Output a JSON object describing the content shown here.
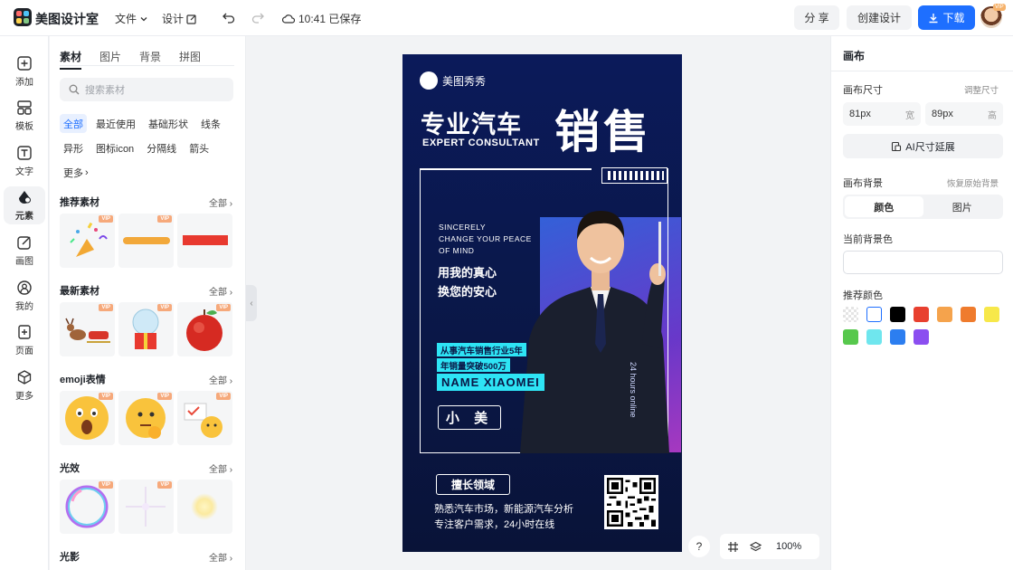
{
  "topbar": {
    "app_title": "美图设计室",
    "menu_file": "文件",
    "menu_design": "设计",
    "saved_status": "10:41 已保存",
    "share_label": "分 享",
    "create_label": "创建设计",
    "download_label": "下载",
    "avatar_badge": "VIP"
  },
  "rail": {
    "items": [
      {
        "label": "添加",
        "icon": "plus-square-icon"
      },
      {
        "label": "模板",
        "icon": "template-icon"
      },
      {
        "label": "文字",
        "icon": "text-icon"
      },
      {
        "label": "元素",
        "icon": "shapes-icon"
      },
      {
        "label": "画图",
        "icon": "draw-icon"
      },
      {
        "label": "我的",
        "icon": "user-icon"
      },
      {
        "label": "页面",
        "icon": "page-add-icon"
      },
      {
        "label": "更多",
        "icon": "cube-icon"
      }
    ]
  },
  "panel": {
    "tabs": [
      "素材",
      "图片",
      "背景",
      "拼图"
    ],
    "search_placeholder": "搜索素材",
    "tags": [
      "全部",
      "最近使用",
      "基础形状",
      "线条",
      "异形",
      "图标icon",
      "分隔线",
      "箭头",
      "更多"
    ],
    "all_label": "全部",
    "vip_label": "VIP",
    "sections": [
      {
        "title": "推荐素材"
      },
      {
        "title": "最新素材"
      },
      {
        "title": "emoji表情"
      },
      {
        "title": "光效"
      },
      {
        "title": "光影"
      }
    ]
  },
  "poster": {
    "brand": "美图秀秀",
    "title_left": "专业汽车",
    "title_en": "EXPERT CONSULTANT",
    "title_right": "销售",
    "en_line1": "SINCERELY",
    "en_line2": "CHANGE YOUR PEACE",
    "en_line3": "OF MIND",
    "cn_line1": "用我的真心",
    "cn_line2": "换您的安心",
    "exp_line1": "从事汽车销售行业5年",
    "exp_line2": "年销量突破500万",
    "name_en": "NAME XIAOMEI",
    "name_cn": "小 美",
    "online": "24 hours online",
    "skill_title": "擅长领域",
    "skill_line1": "熟悉汽车市场，新能源汽车分析",
    "skill_line2": "专注客户需求，24小时在线"
  },
  "bottom": {
    "help": "?",
    "zoom": "100%"
  },
  "right": {
    "title": "画布",
    "size_label": "画布尺寸",
    "adjust_link": "调整尺寸",
    "width_value": "81px",
    "width_unit": "宽",
    "height_value": "89px",
    "height_unit": "高",
    "ai_button": "AI尺寸延展",
    "bg_label": "画布背景",
    "restore_link": "恢复原始背景",
    "seg_color": "颜色",
    "seg_image": "图片",
    "current_bg_label": "当前背景色",
    "recommend_label": "推荐颜色",
    "swatches": [
      "transparent",
      "#ffffff",
      "#000000",
      "#e8402f",
      "#f5a34c",
      "#ef7b2d",
      "#f7e84a",
      "#57c84d",
      "#6fe6ee",
      "#2c7ef0",
      "#8b4ef0"
    ]
  }
}
